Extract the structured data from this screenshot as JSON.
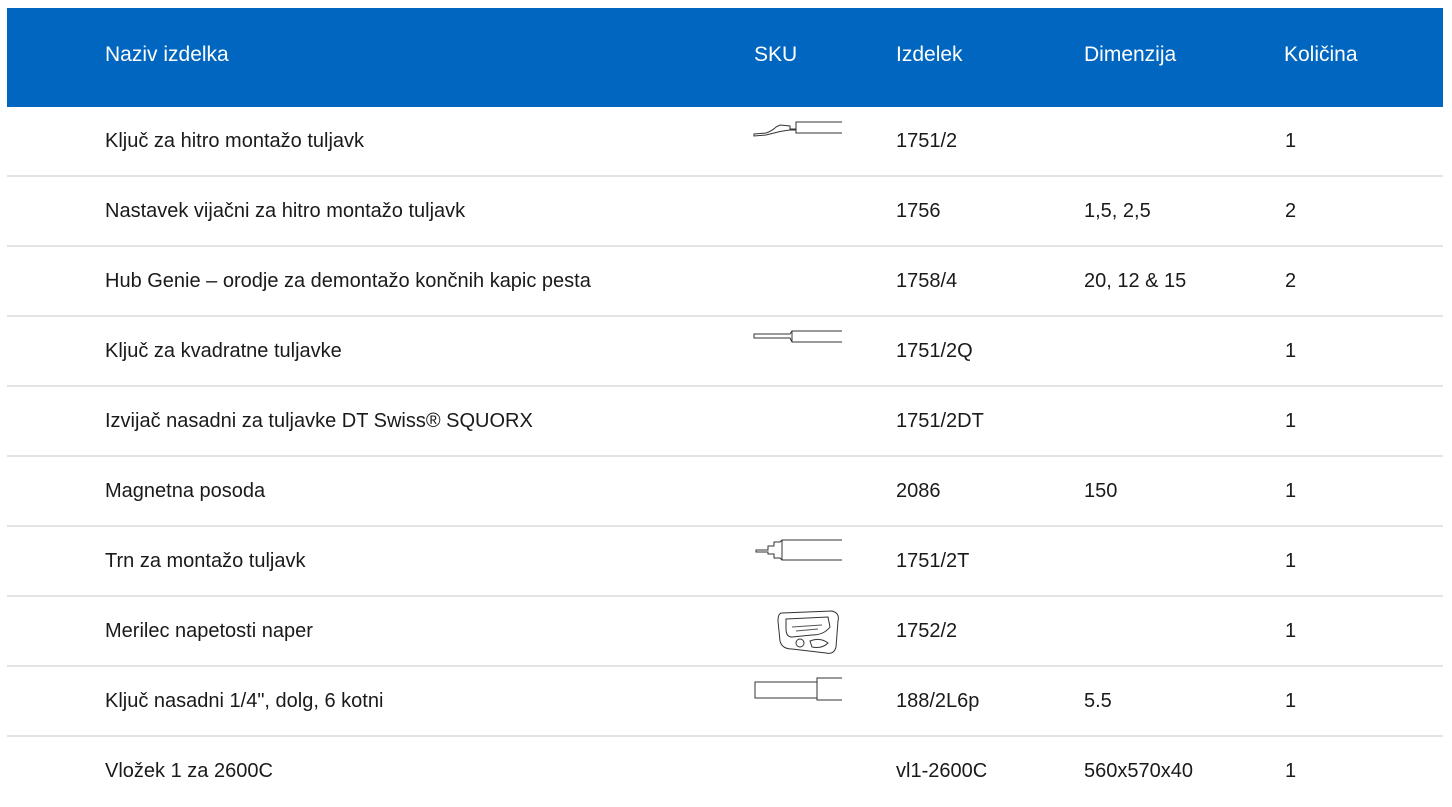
{
  "header": {
    "name": "Naziv izdelka",
    "sku": "SKU",
    "item": "Izdelek",
    "dimension": "Dimenzija",
    "quantity": "Količina"
  },
  "rows": [
    {
      "name": "Ključ za hitro montažo tuljavk",
      "image": "spoke-wrench-bent-icon",
      "item": "1751/2",
      "dimension": "",
      "quantity": "1"
    },
    {
      "name": "Nastavek vijačni za hitro montažo tuljavk",
      "image": "",
      "item": "1756",
      "dimension": "1,5, 2,5",
      "quantity": "2"
    },
    {
      "name": "Hub Genie – orodje za demontažo končnih kapic pesta",
      "image": "",
      "item": "1758/4",
      "dimension": "20, 12 & 15",
      "quantity": "2"
    },
    {
      "name": "Ključ za kvadratne tuljavke",
      "image": "spoke-wrench-straight-icon",
      "item": "1751/2Q",
      "dimension": "",
      "quantity": "1"
    },
    {
      "name": "Izvijač nasadni za tuljavke DT Swiss® SQUORX",
      "image": "",
      "item": "1751/2DT",
      "dimension": "",
      "quantity": "1"
    },
    {
      "name": "Magnetna posoda",
      "image": "",
      "item": "2086",
      "dimension": "150",
      "quantity": "1"
    },
    {
      "name": "Trn za montažo tuljavk",
      "image": "nipple-holder-icon",
      "item": "1751/2T",
      "dimension": "",
      "quantity": "1"
    },
    {
      "name": "Merilec napetosti naper",
      "image": "tension-meter-icon",
      "item": "1752/2",
      "dimension": "",
      "quantity": "1"
    },
    {
      "name": "Ključ nasadni 1/4\", dolg, 6 kotni",
      "image": "socket-long-icon",
      "item": "188/2L6p",
      "dimension": "5.5",
      "quantity": "1"
    },
    {
      "name": "Vložek 1 za 2600C",
      "image": "",
      "item": "vl1-2600C",
      "dimension": "560x570x40",
      "quantity": "1"
    }
  ],
  "colors": {
    "header_bg": "#0066bf",
    "header_text": "#ffffff",
    "divider": "#e4e4e4"
  }
}
